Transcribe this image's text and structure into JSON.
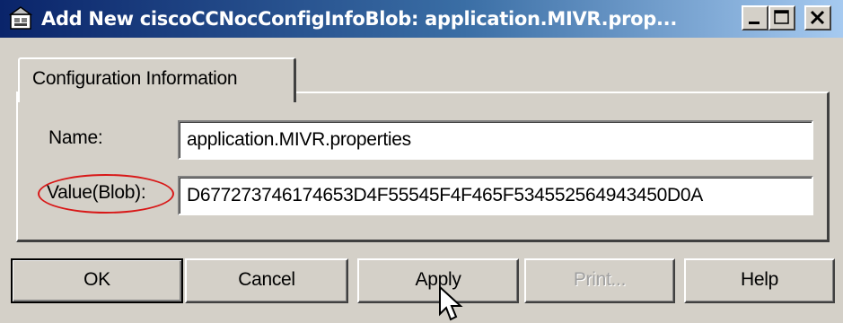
{
  "window": {
    "title": "Add New ciscoCCNocConfigInfoBlob: application.MIVR.prop...",
    "icon": "dialog-config-icon",
    "controls": {
      "minimize": "minimize-icon",
      "maximize": "maximize-icon",
      "close": "close-icon"
    }
  },
  "tabs": [
    {
      "label": "Configuration Information",
      "active": true
    }
  ],
  "form": {
    "name_label": "Name:",
    "name_value": "application.MIVR.properties",
    "value_label": "Value(Blob):",
    "value_value": "D677273746174653D4F55545F4F465F534552564943450D0A",
    "highlight_color": "#d81818"
  },
  "buttons": {
    "ok": "OK",
    "cancel": "Cancel",
    "apply": "Apply",
    "print": "Print...",
    "help": "Help"
  },
  "colors": {
    "titlebar_start": "#0a246a",
    "titlebar_end": "#a6caf0",
    "face": "#d4d0c8"
  }
}
